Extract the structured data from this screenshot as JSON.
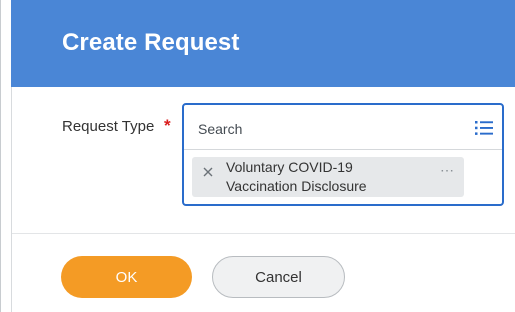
{
  "dialog": {
    "title": "Create Request"
  },
  "form": {
    "request_type": {
      "label": "Request Type",
      "required_marker": "*",
      "search_placeholder": "Search",
      "selected_items": [
        {
          "label": "Voluntary COVID-19 Vaccination Disclosure",
          "more_glyph": "⋯"
        }
      ]
    }
  },
  "footer": {
    "ok_label": "OK",
    "cancel_label": "Cancel"
  },
  "icons": {
    "list": "list-icon",
    "remove": "close-icon",
    "more": "more-icon"
  },
  "colors": {
    "header": "#4a86d6",
    "primary_button": "#f49b25",
    "required": "#d91c1c",
    "focus_border": "#2a6ccb"
  }
}
